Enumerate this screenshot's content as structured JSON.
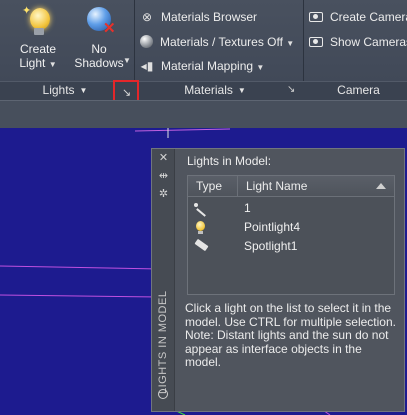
{
  "ribbon": {
    "lights_panel": {
      "create_light": {
        "line1": "Create",
        "line2": "Light"
      },
      "no_shadows": {
        "line1": "No",
        "line2": "Shadows"
      },
      "title": "Lights"
    },
    "materials_panel": {
      "materials_browser": "Materials Browser",
      "materials_textures": "Materials / Textures Off",
      "material_mapping": "Material Mapping",
      "title": "Materials"
    },
    "camera_panel": {
      "create_camera": "Create Camera",
      "show_cameras": "Show  Cameras",
      "title": "Camera"
    }
  },
  "palette": {
    "vertical_title": "LIGHTS IN MODEL",
    "heading": "Lights in Model:",
    "columns": {
      "type": "Type",
      "name": "Light Name"
    },
    "lights": [
      {
        "type_icon": "distant-light-icon",
        "name": "1"
      },
      {
        "type_icon": "point-light-icon",
        "name": "Pointlight4"
      },
      {
        "type_icon": "spotlight-icon",
        "name": "Spotlight1"
      }
    ],
    "description": "Click a light on the list to select it in the model. Use CTRL for multiple selection. Note: Distant lights and the sun do not appear as interface objects in the model."
  },
  "colors": {
    "viewport_bg": "#1d1b8f",
    "highlight_box": "#e4262a",
    "ribbon_bg": "#444c5a"
  }
}
